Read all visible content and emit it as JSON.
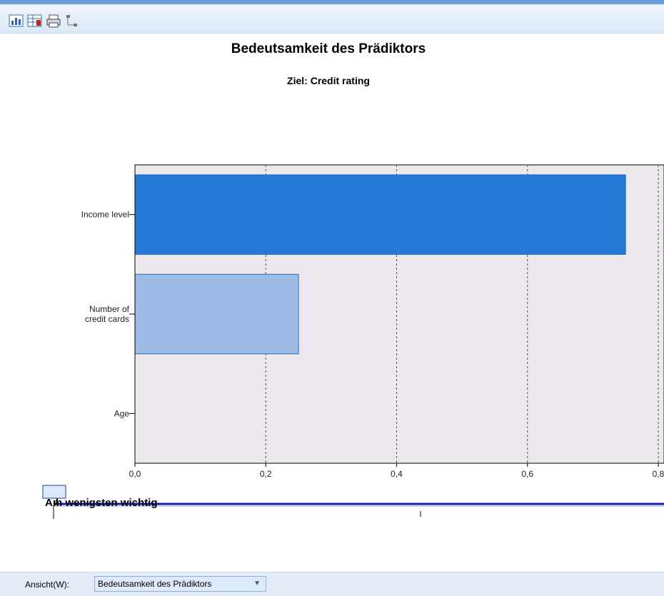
{
  "toolbar": {
    "icons": [
      "chart-editor-icon",
      "table-copy-icon",
      "print-icon",
      "tree-view-icon"
    ]
  },
  "chart_title": "Bedeutsamkeit des Prädiktors",
  "chart_subtitle": "Ziel: Credit rating",
  "chart_data": {
    "type": "bar",
    "orientation": "horizontal",
    "categories": [
      "Income level",
      "Number of credit cards",
      "Age"
    ],
    "category_display": [
      [
        "Income level"
      ],
      [
        "Number of",
        "credit cards"
      ],
      [
        "Age"
      ]
    ],
    "values": [
      0.75,
      0.25,
      0.0
    ],
    "xlim": [
      0,
      0.8
    ],
    "xticks": [
      0.0,
      0.2,
      0.4,
      0.6,
      0.8
    ],
    "xtick_labels": [
      "0,0",
      "0,2",
      "0,4",
      "0,6",
      "0,8"
    ],
    "grid": "vertical dashed",
    "colors": [
      "#2479d4",
      "#9dbce6",
      "#9dbce6"
    ],
    "plot_background": "#ece8ee"
  },
  "slider": {
    "label": "Am wenigsten wichtig",
    "value": 0
  },
  "statusbar": {
    "view_label": "Ansicht(W):",
    "view_value": "Bedeutsamkeit des Prädiktors"
  }
}
